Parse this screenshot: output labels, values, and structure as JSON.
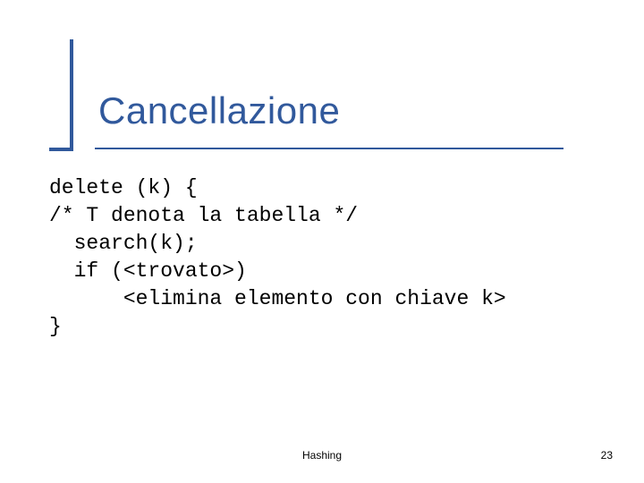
{
  "title": "Cancellazione",
  "code": "delete (k) {\n/* T denota la tabella */\n  search(k);\n  if (<trovato>)\n      <elimina elemento con chiave k>\n}",
  "footer": {
    "center": "Hashing",
    "page": "23"
  }
}
